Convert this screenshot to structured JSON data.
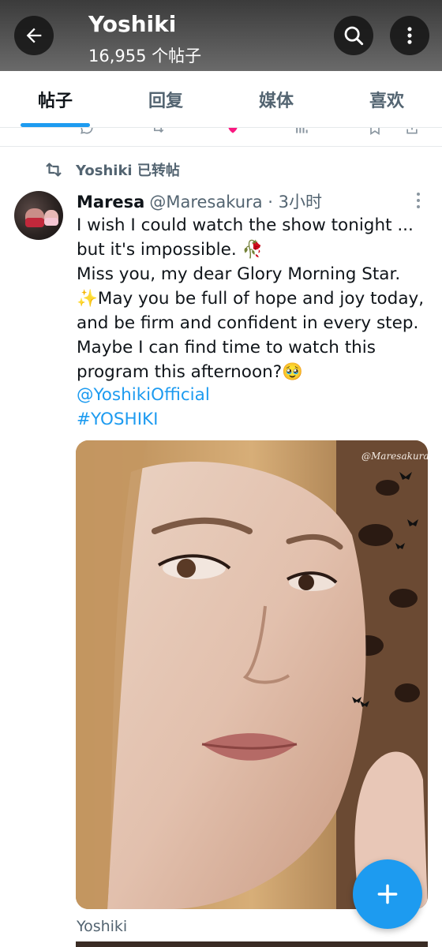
{
  "header": {
    "title": "Yoshiki",
    "subtitle": "16,955 个帖子"
  },
  "tabs": [
    {
      "label": "帖子",
      "active": true
    },
    {
      "label": "回复",
      "active": false
    },
    {
      "label": "媒体",
      "active": false
    },
    {
      "label": "喜欢",
      "active": false
    }
  ],
  "retweet": {
    "label": "Yoshiki 已转帖",
    "icon": "retweet-icon"
  },
  "tweet": {
    "author_name": "Maresa",
    "author_handle": "@Maresakura",
    "time": " · 3小时",
    "text": "I wish I could watch the show tonight ...\nbut it's impossible. 🥀\nMiss you, my dear Glory Morning Star.\n✨May you be full of hope and joy today,\nand be firm and confident in every step.\nMaybe I can find time to watch this\nprogram this afternoon?🥹",
    "mention": "@YoshikiOfficial",
    "hashtag": "#YOSHIKI",
    "image_watermark": "@Maresakura",
    "media_caption": "Yoshiki"
  },
  "colors": {
    "accent": "#1d9bf0",
    "text_primary": "#0f1419",
    "text_secondary": "#536471"
  },
  "icons": {
    "back": "arrow-left-icon",
    "search": "search-icon",
    "more": "more-vertical-icon",
    "compose": "plus-icon"
  }
}
